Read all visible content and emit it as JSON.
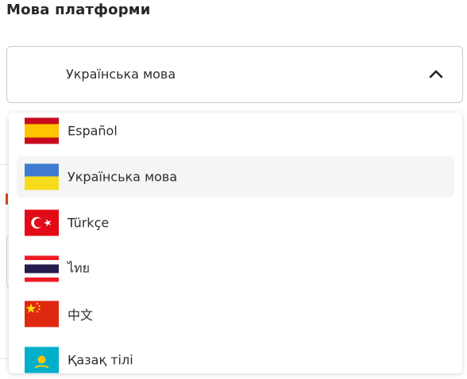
{
  "section": {
    "title": "Мова платформи"
  },
  "select": {
    "value": "Українська мова",
    "icon": "chevron-up-icon"
  },
  "options": [
    {
      "label": "Español",
      "flag": "spain-flag-icon"
    },
    {
      "label": "Українська мова",
      "flag": "ukraine-flag-icon",
      "selected": true
    },
    {
      "label": "Türkçe",
      "flag": "turkey-flag-icon"
    },
    {
      "label": "ไทย",
      "flag": "thailand-flag-icon"
    },
    {
      "label": "中文",
      "flag": "china-flag-icon"
    },
    {
      "label": "Қазақ тілі",
      "flag": "kazakhstan-flag-icon"
    }
  ],
  "colors": {
    "selected_bg": "#f4f5f4",
    "border": "#c9c9c9",
    "text": "#2d2d2d"
  }
}
